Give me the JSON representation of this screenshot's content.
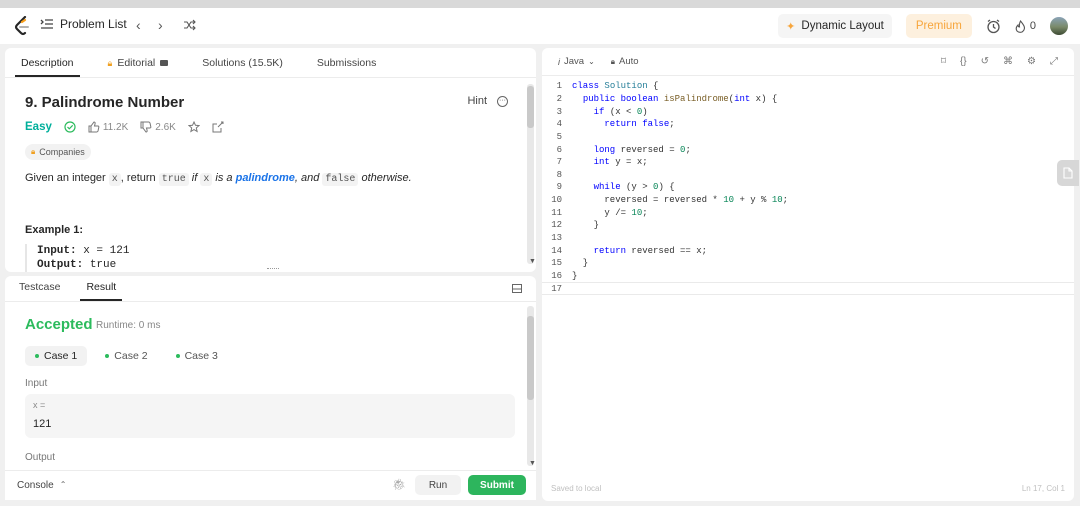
{
  "nav": {
    "problem_list": "Problem List",
    "dynamic_layout": "Dynamic Layout",
    "premium": "Premium",
    "streak_count": "0"
  },
  "desc_tabs": [
    "Description",
    "Editorial",
    "Solutions (15.5K)",
    "Submissions"
  ],
  "problem": {
    "title": "9. Palindrome Number",
    "hint": "Hint",
    "difficulty": "Easy",
    "likes": "11.2K",
    "dislikes": "2.6K",
    "companies": "Companies",
    "desc_pre": "Given an integer ",
    "desc_x": "x",
    "desc_mid": ", return ",
    "desc_true": "true",
    "desc_if": " if ",
    "desc_x2": "x",
    "desc_isa": " is a ",
    "desc_pal": "palindrome",
    "desc_and": ", and ",
    "desc_false": "false",
    "desc_other": " otherwise.",
    "example_title": "Example 1:",
    "ex_input_label": "Input:",
    "ex_input_value": " x = 121",
    "ex_output_label": "Output:",
    "ex_output_value": " true"
  },
  "result_tabs": [
    "Testcase",
    "Result"
  ],
  "result": {
    "status": "Accepted",
    "runtime": "Runtime: 0 ms",
    "cases": [
      "Case 1",
      "Case 2",
      "Case 3"
    ],
    "input_label": "Input",
    "var_name": "x =",
    "var_value": "121",
    "output_label": "Output"
  },
  "console": {
    "label": "Console",
    "run": "Run",
    "submit": "Submit"
  },
  "editor": {
    "language": "Java",
    "mode": "Auto",
    "saved": "Saved to local",
    "cursor": "Ln 17, Col 1"
  },
  "code_lines": [
    "class Solution {",
    "  public boolean isPalindrome(int x) {",
    "    if (x < 0)",
    "      return false;",
    "",
    "    long reversed = 0;",
    "    int y = x;",
    "",
    "    while (y > 0) {",
    "      reversed = reversed * 10 + y % 10;",
    "      y /= 10;",
    "    }",
    "",
    "    return reversed == x;",
    "  }",
    "}",
    ""
  ],
  "colors": {
    "accepted": "#2cbb5d",
    "easy": "#00af9b",
    "premium": "#f7a53b",
    "submit": "#2db55d",
    "link": "#1a73e8"
  }
}
